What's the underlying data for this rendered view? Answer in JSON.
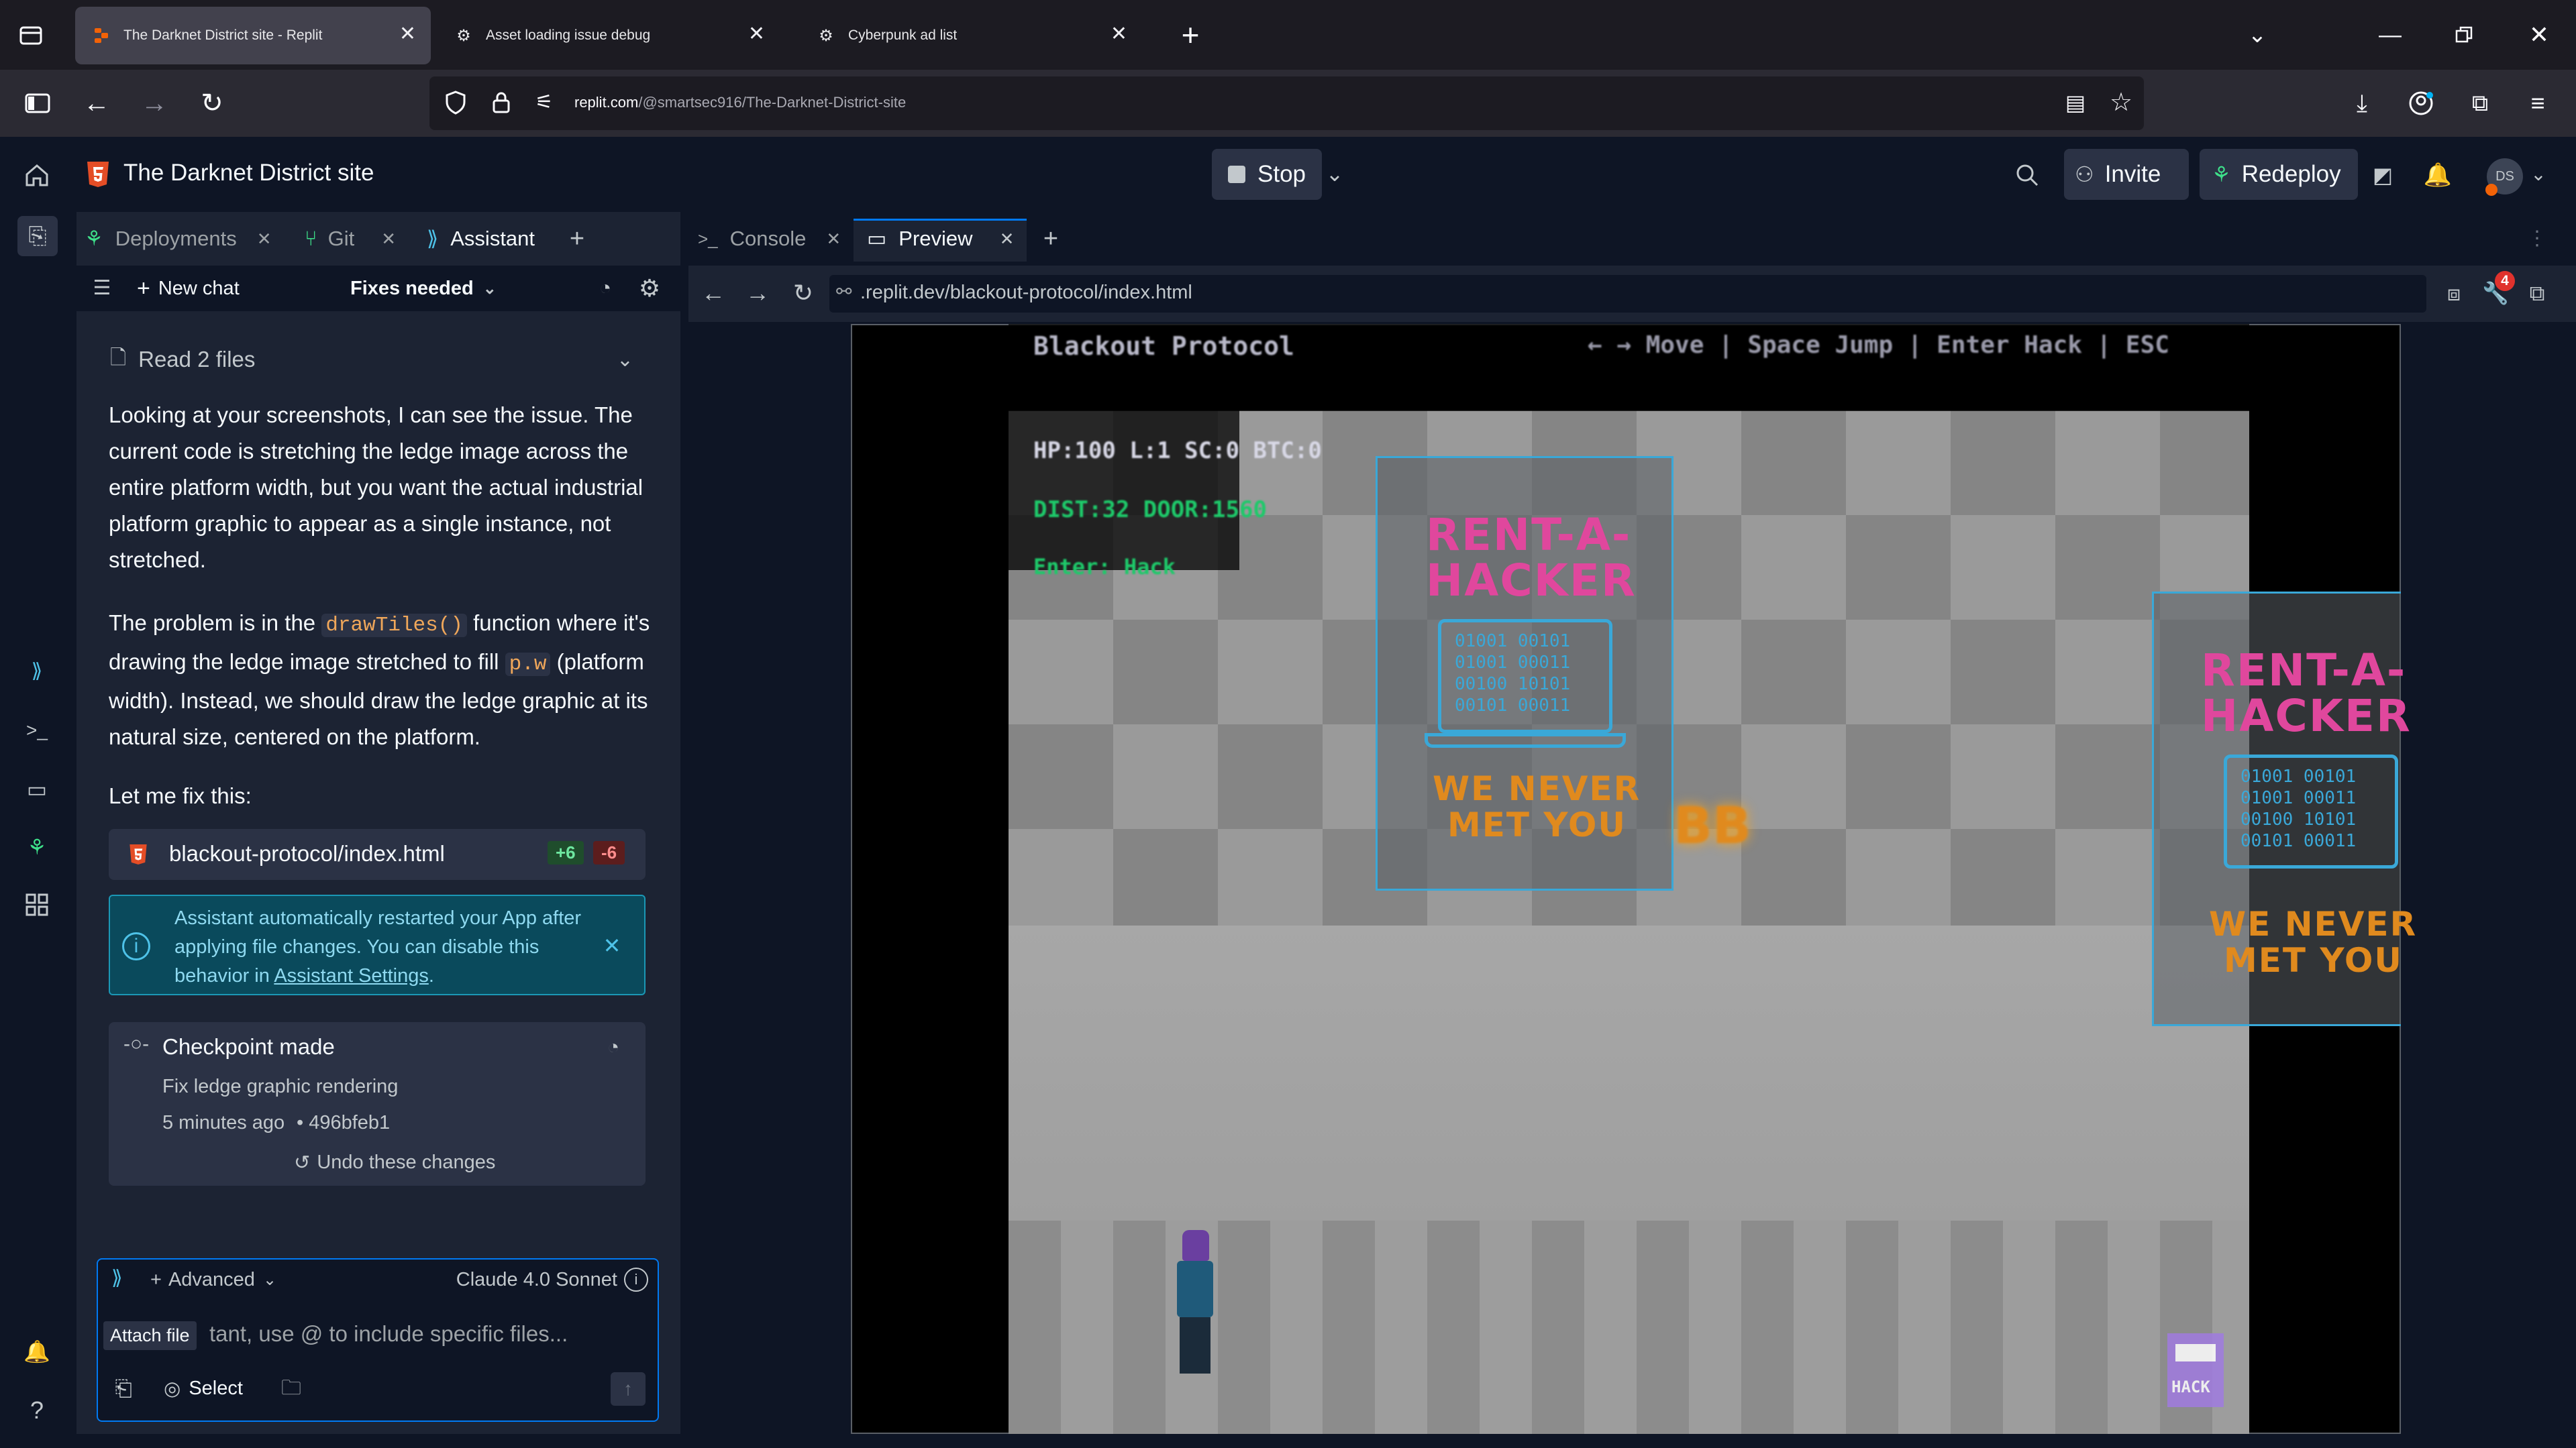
{
  "browser": {
    "tabs": [
      {
        "title": "The Darknet District site - Replit"
      },
      {
        "title": "Asset loading issue debug"
      },
      {
        "title": "Cyberpunk ad list"
      }
    ],
    "url": {
      "host": "replit.com",
      "path": "/@smartsec916/The-Darknet-District-site"
    }
  },
  "header": {
    "project_name": "The Darknet District site",
    "stop_label": "Stop",
    "invite_label": "Invite",
    "redeploy_label": "Redeploy",
    "avatar_initials": "DS"
  },
  "left_tabs": [
    {
      "label": "Deployments"
    },
    {
      "label": "Git"
    },
    {
      "label": "Assistant"
    }
  ],
  "assistant": {
    "new_chat_label": "New chat",
    "chat_title": "Fixes needed",
    "read_files": "Read 2 files",
    "para1": "Looking at your screenshots, I can see the issue. The current code is stretching the ledge image across the entire platform width, but you want the actual industrial platform graphic to appear as a single instance, not stretched.",
    "para2_a": "The problem is in the",
    "para2_code1": "drawTiles()",
    "para2_b": "function where it's drawing the ledge image stretched to fill",
    "para2_code2": "p.w",
    "para2_c": "(platform width). Instead, we should draw the ledge graphic at its natural size, centered on the platform.",
    "para3": "Let me fix this:",
    "file": {
      "name": "blackout-protocol/index.html",
      "added": "+6",
      "removed": "-6"
    },
    "notice": {
      "text": "Assistant automatically restarted your App after applying file changes. You can disable this behavior in",
      "link": "Assistant Settings",
      "tail": "."
    },
    "checkpoint": {
      "title": "Checkpoint made",
      "desc": "Fix ledge graphic rendering",
      "time": "5 minutes ago",
      "hash": "496bfeb1",
      "undo": "Undo these changes"
    },
    "input": {
      "mode": "Advanced",
      "model": "Claude 4.0 Sonnet",
      "placeholder": "tant, use @ to include specific files...",
      "tooltip": "Attach file",
      "select_label": "Select"
    }
  },
  "right_tabs": [
    {
      "label": "Console"
    },
    {
      "label": "Preview"
    }
  ],
  "preview": {
    "url": ".replit.dev/blackout-protocol/index.html",
    "badge_count": "4"
  },
  "game": {
    "title": "Blackout Protocol",
    "controls": "← → Move | Space Jump | Enter Hack | ESC",
    "hud_line1": "HP:100  L:1  SC:0  BTC:0",
    "hud_line2": "DIST:32  DOOR:1560",
    "hud_line3": "Enter: Hack",
    "ad": {
      "line1": "RENT-A-",
      "line2": "HACKER",
      "binary1": "01001 00101",
      "binary2": "01001 00011",
      "binary3": "00100 10101",
      "binary4": "00101 00011",
      "line3": "WE NEVER",
      "line4": "MET YOU"
    },
    "coins": "BB",
    "hack_label": "HACK"
  },
  "colors": {
    "accent": "#0053a6",
    "add": "#1f8a3d",
    "remove": "#a32727",
    "neon_pink": "#e0479d",
    "neon_orange": "#e08a1e",
    "neon_blue": "#3aa8d8"
  }
}
